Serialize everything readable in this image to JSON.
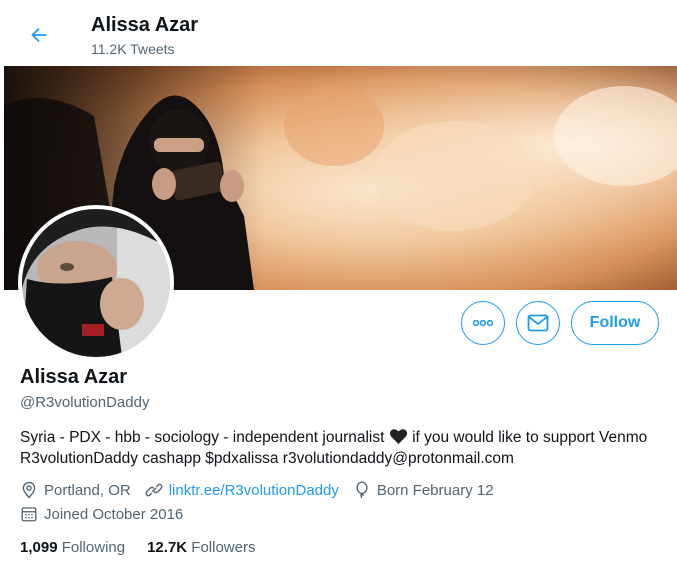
{
  "header": {
    "title": "Alissa Azar",
    "tweet_count": "11.2K Tweets"
  },
  "actions": {
    "more_icon": "more-dots-icon",
    "message_icon": "envelope-icon",
    "follow_label": "Follow"
  },
  "profile": {
    "display_name": "Alissa Azar",
    "handle": "@R3volutionDaddy",
    "bio_before_heart": "Syria - PDX - hbb - sociology - independent journalist ",
    "bio_heart_icon": "black-heart-icon",
    "bio_after_heart": "if you would like to support Venmo R3volutionDaddy cashapp $pdxalissa r3volutiondaddy@protonmail.com",
    "location": "Portland, OR",
    "website": "linktr.ee/R3volutionDaddy",
    "birthday": "Born February 12",
    "joined": "Joined October 2016"
  },
  "stats": {
    "following_count": "1,099",
    "following_label": "Following",
    "followers_count": "12.7K",
    "followers_label": "Followers"
  },
  "colors": {
    "accent": "#1d9bf0",
    "text_primary": "#0f1419",
    "text_secondary": "#536471"
  }
}
